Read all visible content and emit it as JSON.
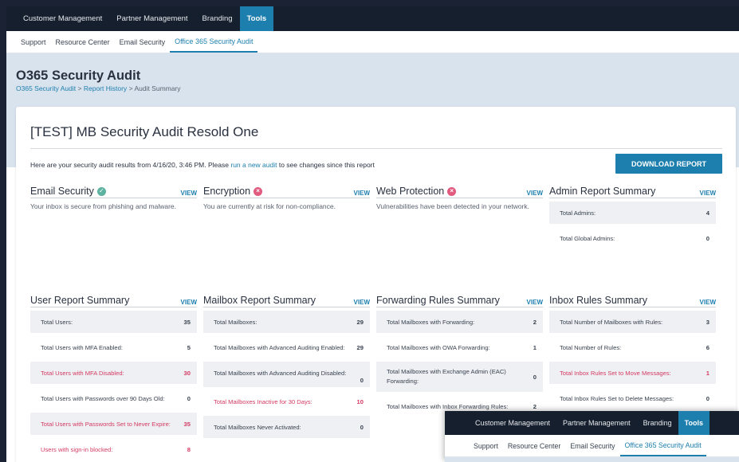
{
  "topnav": [
    "Customer Management",
    "Partner Management",
    "Branding",
    "Tools"
  ],
  "topnav_active": "Tools",
  "subnav": [
    "Support",
    "Resource Center",
    "Email Security",
    "Office 365 Security Audit"
  ],
  "subnav_active": "Office 365 Security Audit",
  "page": {
    "title": "O365 Security Audit",
    "breadcrumb": [
      "O365 Security Audit",
      "Report History",
      "Audit Summary"
    ],
    "breadcrumb_sep": ">"
  },
  "report": {
    "title": "[TEST] MB Security Audit Resold One",
    "intro_prefix": "Here are your security audit results from 4/16/20, 3:46 PM. Please",
    "intro_link": "run a new audit",
    "intro_suffix": "to see changes since this report",
    "download_label": "DOWNLOAD REPORT",
    "view_label": "VIEW"
  },
  "sections_top": [
    {
      "name": "Email Security",
      "status": "ok",
      "desc": "Your inbox is secure from phishing and malware."
    },
    {
      "name": "Encryption",
      "status": "bad",
      "desc": "You are currently at risk for non-compliance."
    },
    {
      "name": "Web Protection",
      "status": "bad",
      "desc": "Vulnerabilities have been detected in your network."
    },
    {
      "name": "Admin Report Summary",
      "rows": [
        {
          "label": "Total Admins:",
          "value": "4"
        },
        {
          "label": "Total Global Admins:",
          "value": "0"
        }
      ]
    }
  ],
  "sections_bottom": [
    {
      "name": "User Report Summary",
      "rows": [
        {
          "label": "Total Users:",
          "value": "35"
        },
        {
          "label": "Total Users with MFA Enabled:",
          "value": "5"
        },
        {
          "label": "Total Users with MFA Disabled:",
          "value": "30",
          "alert": true
        },
        {
          "label": "Total Users with Passwords over 90 Days Old:",
          "value": "0"
        },
        {
          "label": "Total Users with Passwords Set to Never Expire:",
          "value": "35",
          "alert": true
        },
        {
          "label": "Users with sign-in blocked:",
          "value": "8",
          "alert": true
        }
      ]
    },
    {
      "name": "Mailbox Report Summary",
      "rows": [
        {
          "label": "Total Mailboxes:",
          "value": "29"
        },
        {
          "label": "Total Mailboxes with Advanced Auditing Enabled:",
          "value": "29"
        },
        {
          "label": "Total Mailboxes with Advanced Auditing Disabled:",
          "value": "0"
        },
        {
          "label": "Total Mailboxes Inactive for 30 Days:",
          "value": "10",
          "alert": true
        },
        {
          "label": "Total Mailboxes Never Activated:",
          "value": "0"
        }
      ]
    },
    {
      "name": "Forwarding Rules Summary",
      "rows": [
        {
          "label": "Total Mailboxes with Forwarding:",
          "value": "2"
        },
        {
          "label": "Total Mailboxes with OWA Forwarding:",
          "value": "1"
        },
        {
          "label": "Total Mailboxes with Exchange Admin (EAC) Forwarding:",
          "value": "0"
        },
        {
          "label": "Total Mailboxes with Inbox Forwarding Rules:",
          "value": "2"
        }
      ]
    },
    {
      "name": "Inbox Rules Summary",
      "rows": [
        {
          "label": "Total Number of Mailboxes with Rules:",
          "value": "3"
        },
        {
          "label": "Total Number of Rules:",
          "value": "6"
        },
        {
          "label": "Total Inbox Rules Set to Move Messages:",
          "value": "1",
          "alert": true
        },
        {
          "label": "Total Inbox Rules Set to Delete Messages:",
          "value": "0"
        }
      ]
    }
  ],
  "overlay": {
    "topnav": [
      "Customer Management",
      "Partner Management",
      "Branding",
      "Tools"
    ],
    "subnav": [
      "Support",
      "Resource Center",
      "Email Security",
      "Office 365 Security Audit"
    ]
  }
}
